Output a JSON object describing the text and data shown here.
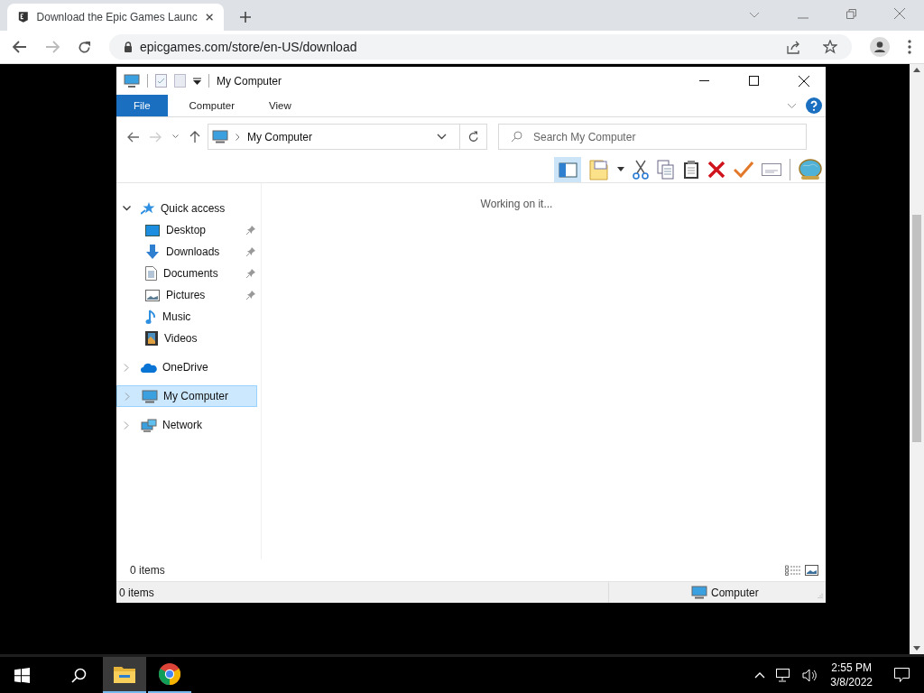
{
  "browser": {
    "tab": {
      "title": "Download the Epic Games Launc",
      "selected": true
    },
    "url": "epicgames.com/store/en-US/download"
  },
  "explorer": {
    "title": "My Computer",
    "ribbon_tabs": [
      {
        "label": "File",
        "selected": true
      },
      {
        "label": "Computer",
        "selected": false
      },
      {
        "label": "View",
        "selected": false
      }
    ],
    "address": "My Computer",
    "search": {
      "placeholder": "Search My Computer"
    },
    "nav": [
      {
        "label": "Quick access",
        "kind": "star",
        "expanded": true,
        "selected": false,
        "children": [
          {
            "label": "Desktop",
            "kind": "desktop",
            "pinned": true
          },
          {
            "label": "Downloads",
            "kind": "download",
            "pinned": true
          },
          {
            "label": "Documents",
            "kind": "document",
            "pinned": true
          },
          {
            "label": "Pictures",
            "kind": "picture",
            "pinned": true
          },
          {
            "label": "Music",
            "kind": "music",
            "pinned": false
          },
          {
            "label": "Videos",
            "kind": "video",
            "pinned": false
          }
        ]
      },
      {
        "label": "OneDrive",
        "kind": "cloud",
        "expanded": false,
        "selected": false
      },
      {
        "label": "My Computer",
        "kind": "computer",
        "expanded": false,
        "selected": true
      },
      {
        "label": "Network",
        "kind": "network",
        "expanded": false,
        "selected": false
      }
    ],
    "message": "Working on it...",
    "items_count": "0 items",
    "status_left": "0 items",
    "status_right": "Computer"
  },
  "taskbar": {
    "apps": [
      {
        "kind": "explorer",
        "active": true
      },
      {
        "kind": "chrome",
        "active": false
      }
    ],
    "time": "2:55 PM",
    "date": "3/8/2022"
  }
}
